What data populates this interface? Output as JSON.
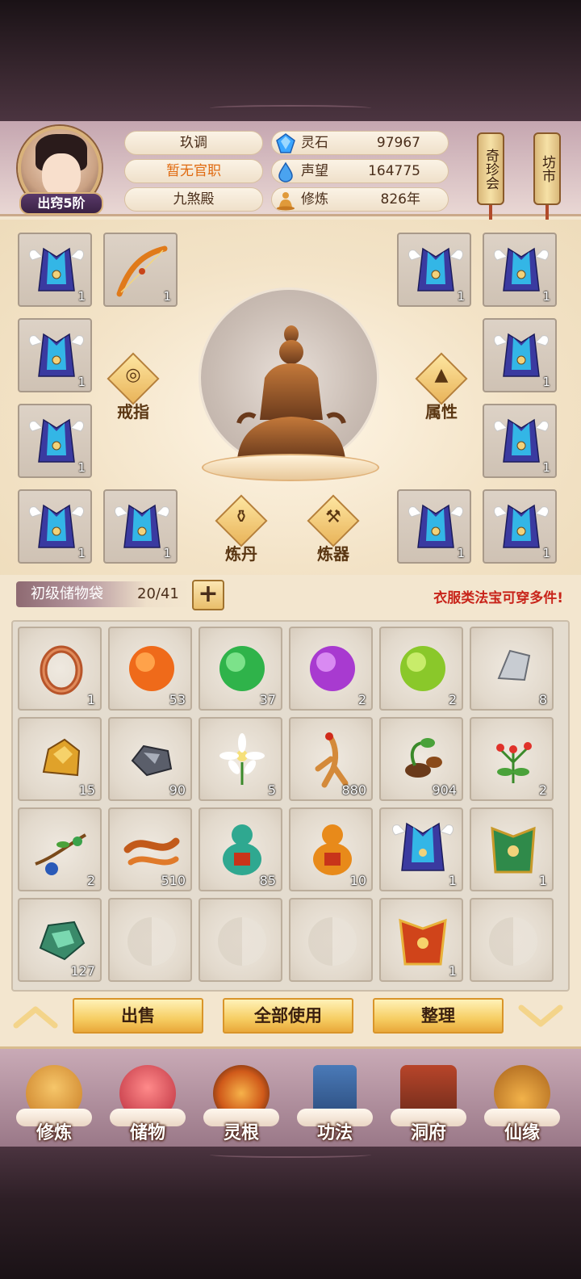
{
  "header": {
    "rank": "出窍5阶",
    "name": "玖调",
    "title": "暂无官职",
    "sect": "九煞殿",
    "resources": [
      {
        "label": "灵石",
        "value": "97967",
        "icon": "blue-crystal-icon"
      },
      {
        "label": "声望",
        "value": "164775",
        "icon": "blue-droplet-icon"
      },
      {
        "label": "修炼",
        "value": "826年",
        "icon": "meditation-icon"
      }
    ],
    "side_buttons": [
      "奇珍会",
      "坊市"
    ]
  },
  "equipment": {
    "slot_count": "1",
    "actions": {
      "ring": "戒指",
      "attributes": "属性",
      "alchemy": "炼丹",
      "forging": "炼器"
    }
  },
  "bag": {
    "name": "初级储物袋",
    "capacity": "20/41",
    "note": "衣服类法宝可穿多件!"
  },
  "inventory": [
    {
      "item": "ring",
      "count": "1"
    },
    {
      "item": "orange-orb",
      "count": "53"
    },
    {
      "item": "green-orb",
      "count": "37"
    },
    {
      "item": "purple-orb",
      "count": "2"
    },
    {
      "item": "lime-orb",
      "count": "2"
    },
    {
      "item": "silver-ore",
      "count": "8"
    },
    {
      "item": "gold-ore",
      "count": "15"
    },
    {
      "item": "iron-ore",
      "count": "90"
    },
    {
      "item": "white-flower",
      "count": "5"
    },
    {
      "item": "ginseng-root",
      "count": "880"
    },
    {
      "item": "herb-root",
      "count": "904"
    },
    {
      "item": "red-flower-herb",
      "count": "2"
    },
    {
      "item": "fruit-branch",
      "count": "2"
    },
    {
      "item": "dried-root",
      "count": "510"
    },
    {
      "item": "jade-gourd",
      "count": "85"
    },
    {
      "item": "orange-gourd",
      "count": "10"
    },
    {
      "item": "winged-robe",
      "count": "1"
    },
    {
      "item": "green-armor",
      "count": "1"
    },
    {
      "item": "jade-stone",
      "count": "127"
    },
    {
      "item": "empty",
      "count": ""
    },
    {
      "item": "empty",
      "count": ""
    },
    {
      "item": "empty",
      "count": ""
    },
    {
      "item": "red-armor",
      "count": "1"
    },
    {
      "item": "empty",
      "count": ""
    }
  ],
  "action_buttons": {
    "sell": "出售",
    "use_all": "全部使用",
    "sort": "整理"
  },
  "nav": [
    "修炼",
    "储物",
    "灵根",
    "功法",
    "洞府",
    "仙缘"
  ]
}
